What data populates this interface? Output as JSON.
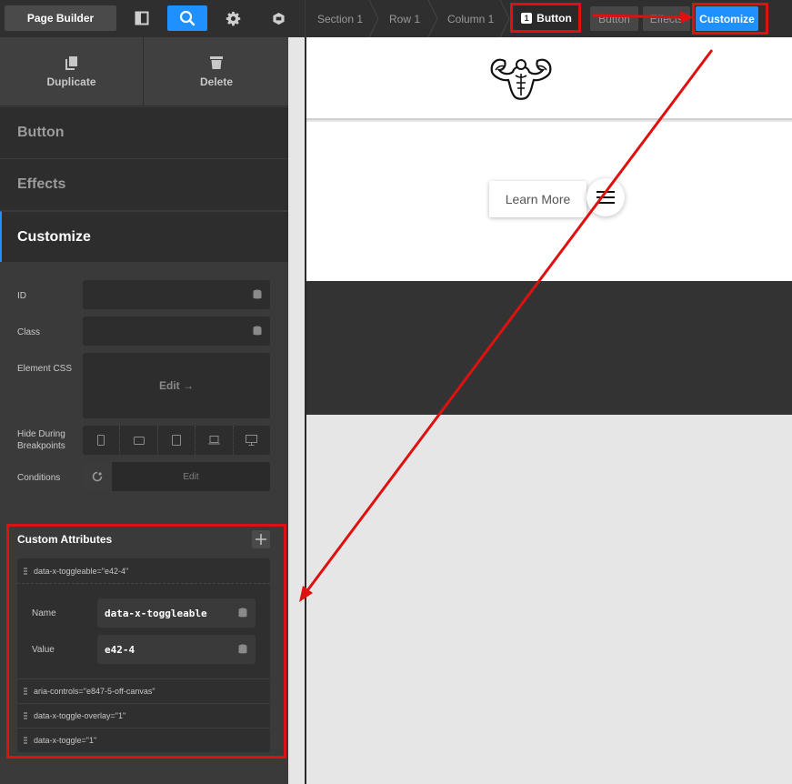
{
  "toolbar": {
    "page_builder_label": "Page Builder",
    "icons": [
      "layout-icon",
      "search-icon",
      "gear-icon",
      "cornerstone-icon"
    ],
    "accent_color": "#1e90ff"
  },
  "breadcrumbs": {
    "section": "Section 1",
    "row": "Row 1",
    "column": "Column 1",
    "element_number": "1",
    "element": "Button"
  },
  "element_tabs": {
    "button": "Button",
    "effects": "Effects",
    "customize": "Customize"
  },
  "panel": {
    "actions": {
      "duplicate": "Duplicate",
      "delete": "Delete"
    },
    "sections": {
      "button": "Button",
      "effects": "Effects",
      "customize": "Customize"
    },
    "fields": {
      "id_label": "ID",
      "id_value": "",
      "class_label": "Class",
      "class_value": "",
      "css_label": "Element CSS",
      "css_edit": "Edit →",
      "hide_label": "Hide During Breakpoints",
      "conditions_label": "Conditions",
      "conditions_edit": "Edit"
    },
    "custom_attributes": {
      "title": "Custom Attributes",
      "items": [
        {
          "summary": "data-x-toggleable=\"e42-4\"",
          "name_label": "Name",
          "name": "data-x-toggleable",
          "value_label": "Value",
          "value": "e42-4"
        },
        {
          "summary": "aria-controls=\"e847-5-off-canvas\""
        },
        {
          "summary": "data-x-toggle-overlay=\"1\""
        },
        {
          "summary": "data-x-toggle=\"1\""
        }
      ]
    }
  },
  "preview": {
    "button_text": "Learn More"
  },
  "annotation_color": "#e01010"
}
